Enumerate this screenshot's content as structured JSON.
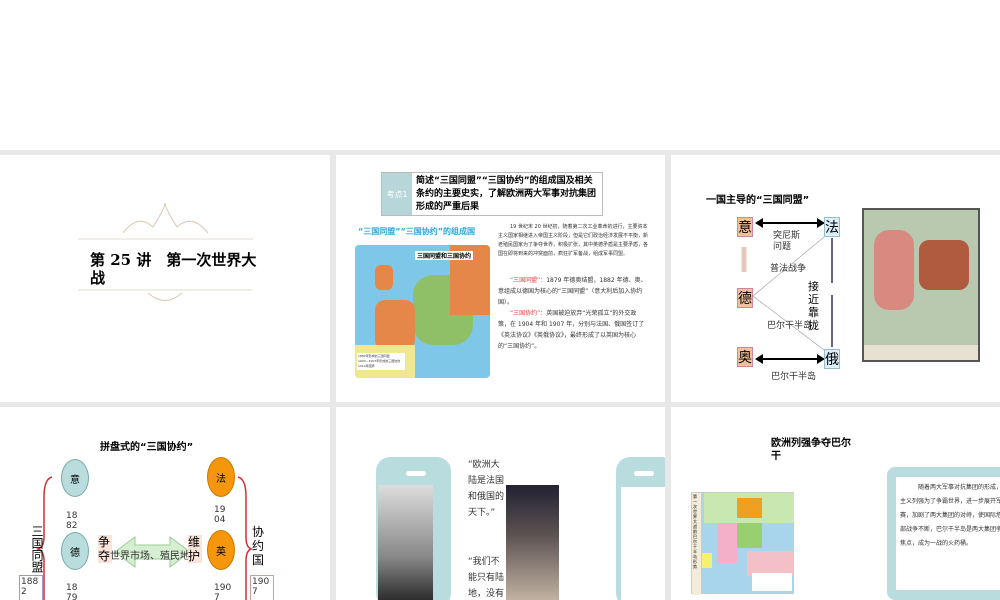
{
  "slides": [
    {
      "title": "第 25 讲　第一次世界大战"
    },
    {
      "badge": "考点1",
      "heading": "简述“三国同盟”“三国协约”的组成国及相关条约的主要史实，了解欧洲两大军事对抗集团形成的严重后果",
      "map_caption": "“三国同盟”“三国协约”的组成国",
      "map_title": "三国同盟和三国协约",
      "legend": [
        "1882年形成的三国同盟",
        "1904—1907年形成的三国协约",
        "1914年国界"
      ],
      "para1": "19 世纪末 20 世纪初，随着第二次工业革命的进行，主要资本主义国家相继进入帝国主义阶段，但是它们政治经济发展不平衡，新老殖民国家为了争夺世界，积极扩张，其中英德矛盾是主要矛盾，各国在即将到来的冲突面前，疯狂扩军备战，组成军事同盟。",
      "p2_label": "“三国同盟”：",
      "p2": "1879 年德奥结盟，1882 年德、奥、意组成以德国为核心的“三国同盟”（意大利后加入协约国）。",
      "p3_label": "“三国协约”：",
      "p3": "英国被迫放弃“光荣孤立”的外交政策，在 1904 年和 1907 年，分别与法国、俄国签订了《英法协议》《英俄协议》，最终形成了以英国为核心的“三国协约”。"
    },
    {
      "heading": "一国主导的“三国同盟”",
      "countries": {
        "italy": "意",
        "france": "法",
        "germany": "德",
        "austria": "奥",
        "russia": "俄"
      },
      "labels": {
        "tunisia": "突尼斯问题",
        "franco_prussian": "普法战争",
        "balkan1": "巴尔干半岛",
        "approach": "接近靠拢",
        "balkan2": "巴尔干半岛"
      }
    },
    {
      "heading": "拼盘式的“三国协约”",
      "countries": {
        "italy": "意",
        "germany": "德",
        "france": "法",
        "britain": "英"
      },
      "years": {
        "y1882a": "1882",
        "y1879": "1879",
        "y1904": "1904",
        "y1907a": "1907",
        "y1882b": "1882",
        "y1907b": "1907"
      },
      "left_group": "三国同盟",
      "right_group": "协约国",
      "compete": "争夺",
      "arrow": "世界市场、殖民地",
      "maintain": "维护"
    },
    {
      "quote1": "“欧洲大陆是法国和俄国的天下。”",
      "quote2": "“我们不能只有陆地，没有海"
    },
    {
      "heading": "欧洲列强争夺巴尔干",
      "map_title": "第一次世界大战前巴尔干半岛形势",
      "text": "随着两大军事对抗集团的形成，帝国主义列强为了争霸世界，进一步展开军备竞赛，加剧了两大集团的对峙，使国际危机局部战争不断，巴尔干半岛是两大集团争夺的焦点，成为一战的火药桶。"
    }
  ]
}
